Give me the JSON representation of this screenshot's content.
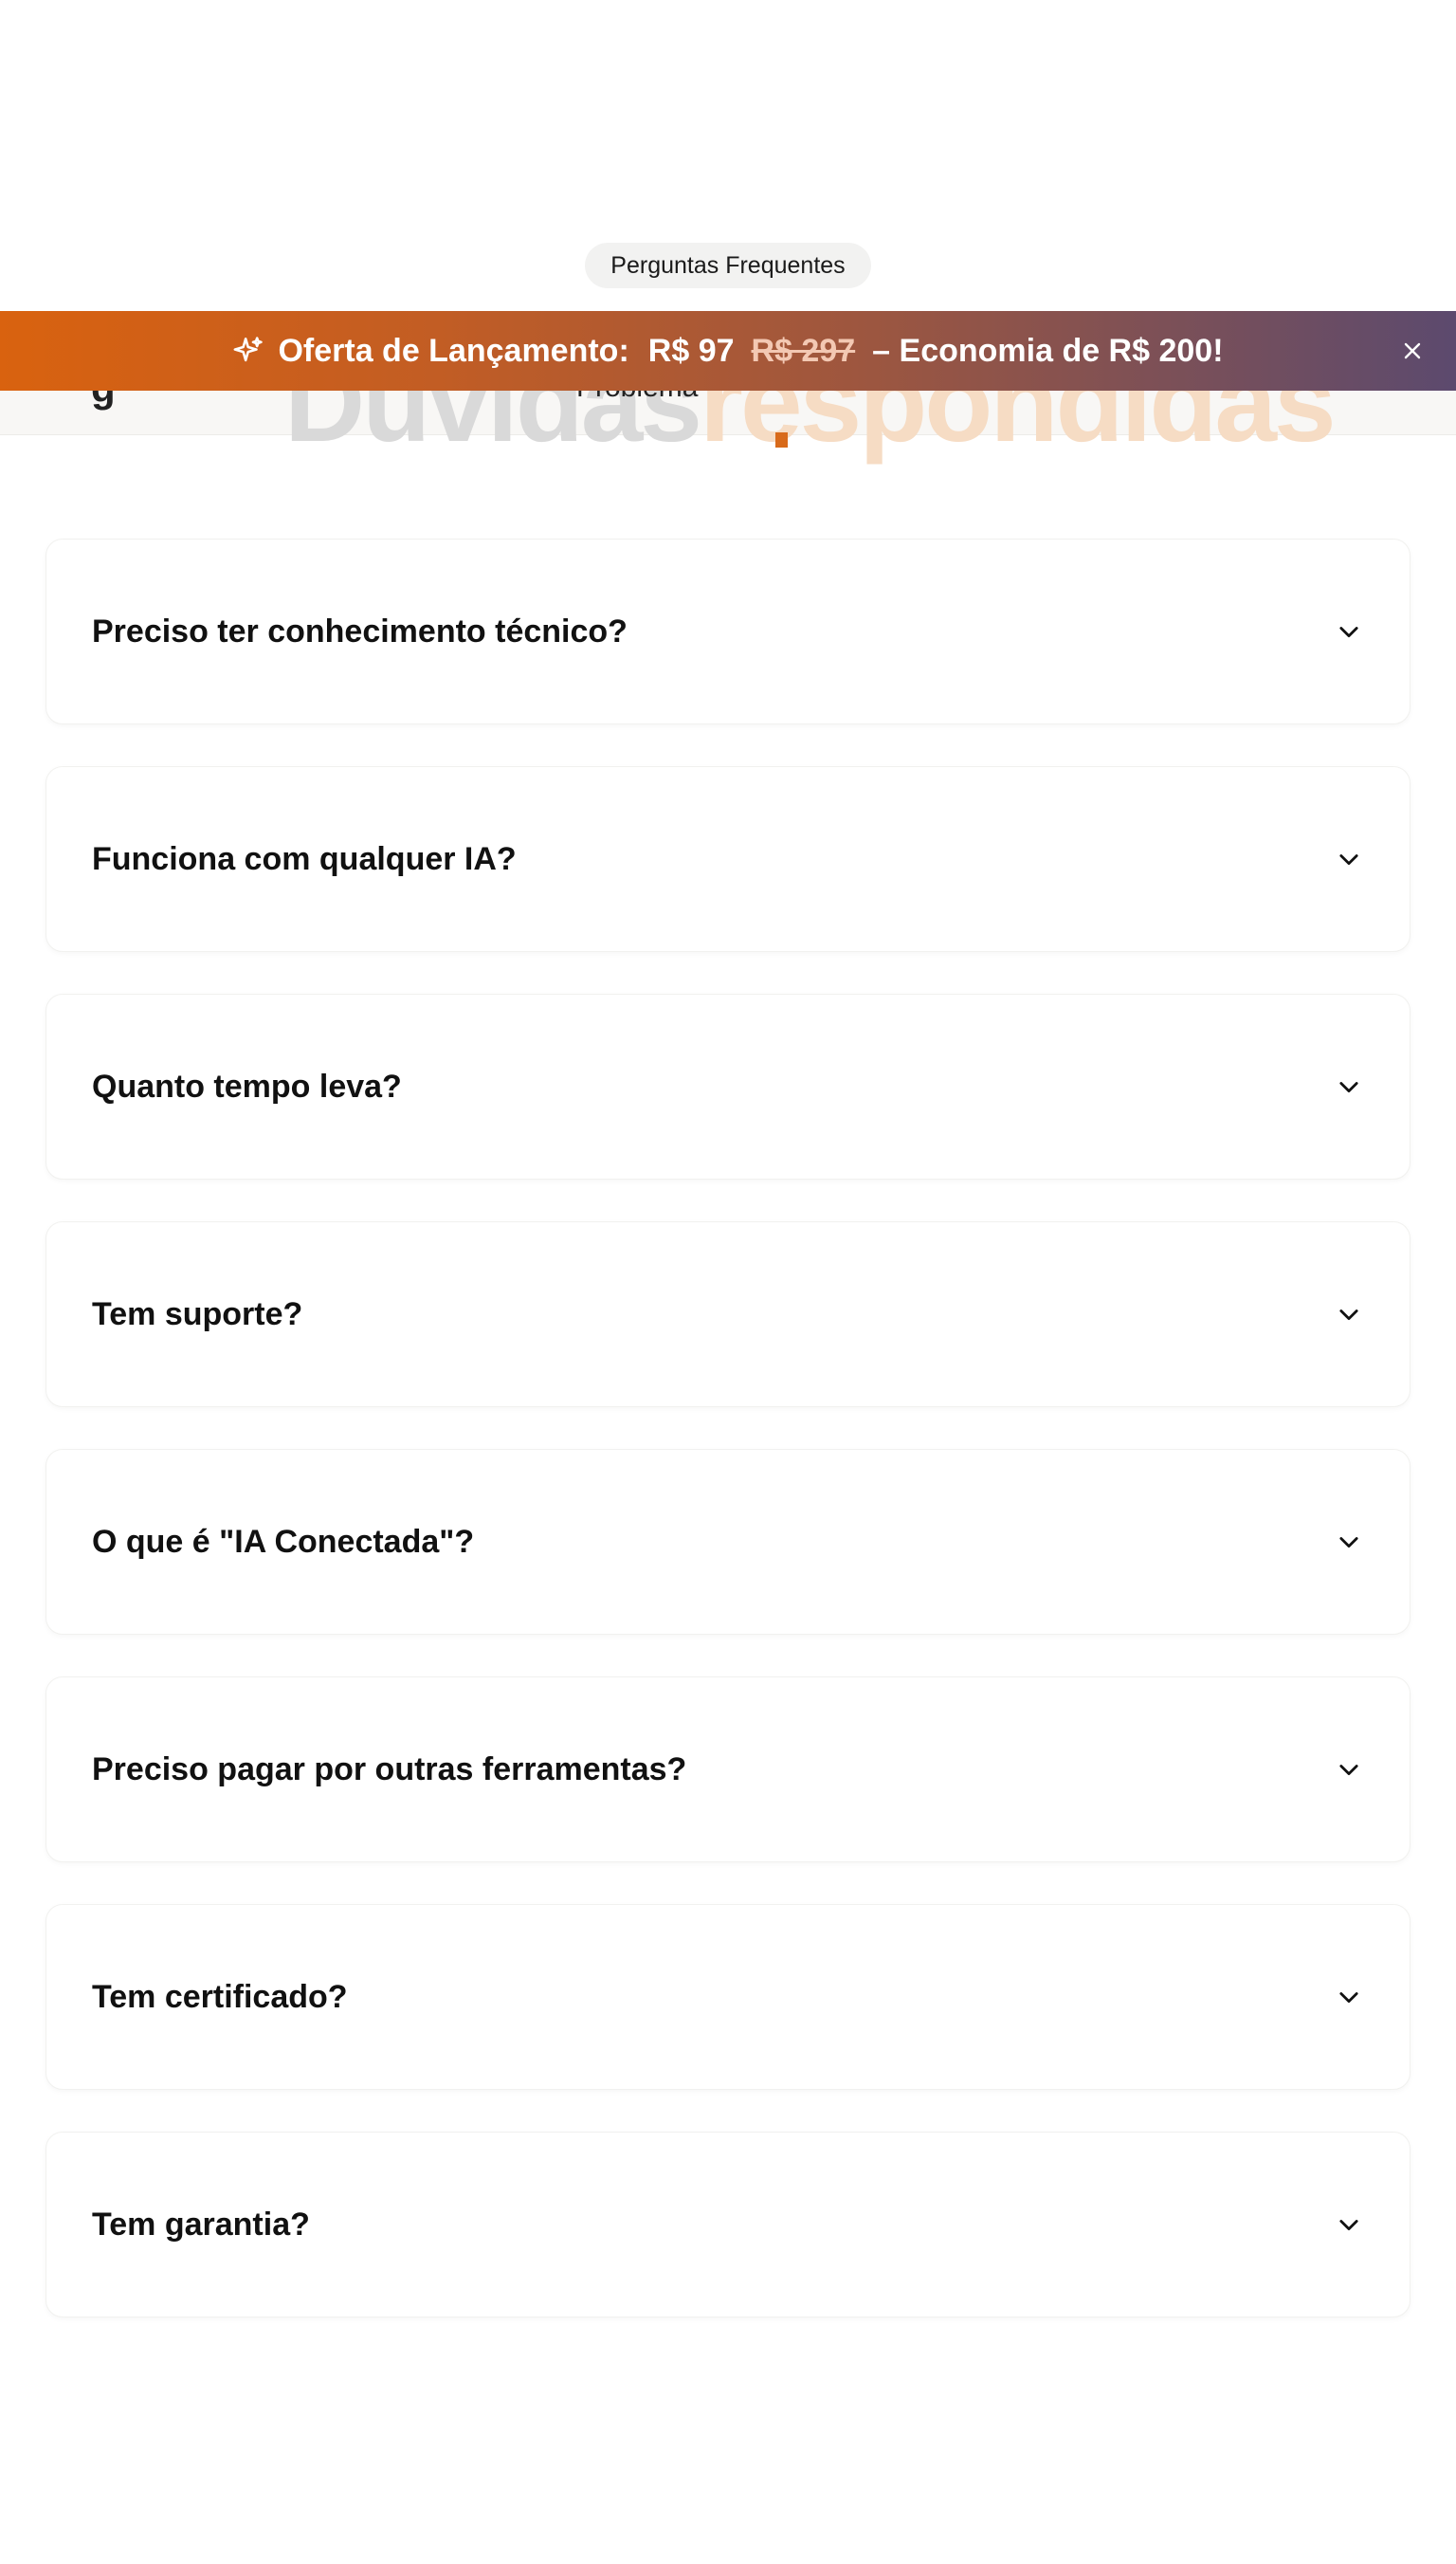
{
  "section": {
    "badge": "Perguntas Frequentes",
    "heading_part1": "Dúvidas",
    "heading_part2": "respondidas",
    "nav_fragment": "Problema",
    "logo_fragment": "g"
  },
  "banner": {
    "label": "Oferta de Lançamento:",
    "price": "R$ 97",
    "old_price": "R$ 297",
    "savings": "– Economia de R$ 200!",
    "icon": "sparkle-icon",
    "close_icon": "close-icon",
    "gradient_colors": [
      "#d9620f",
      "#5c4a6e"
    ]
  },
  "faq": {
    "items": [
      {
        "question": "Preciso ter conhecimento técnico?"
      },
      {
        "question": "Funciona com qualquer IA?"
      },
      {
        "question": "Quanto tempo leva?"
      },
      {
        "question": "Tem suporte?"
      },
      {
        "question": "O que é \"IA Conectada\"?"
      },
      {
        "question": "Preciso pagar por outras ferramentas?"
      },
      {
        "question": "Tem certificado?"
      },
      {
        "question": "Tem garantia?"
      }
    ],
    "expand_icon": "chevron-down-icon"
  },
  "colors": {
    "accent": "#d86a1a",
    "background": "#ffffff"
  }
}
